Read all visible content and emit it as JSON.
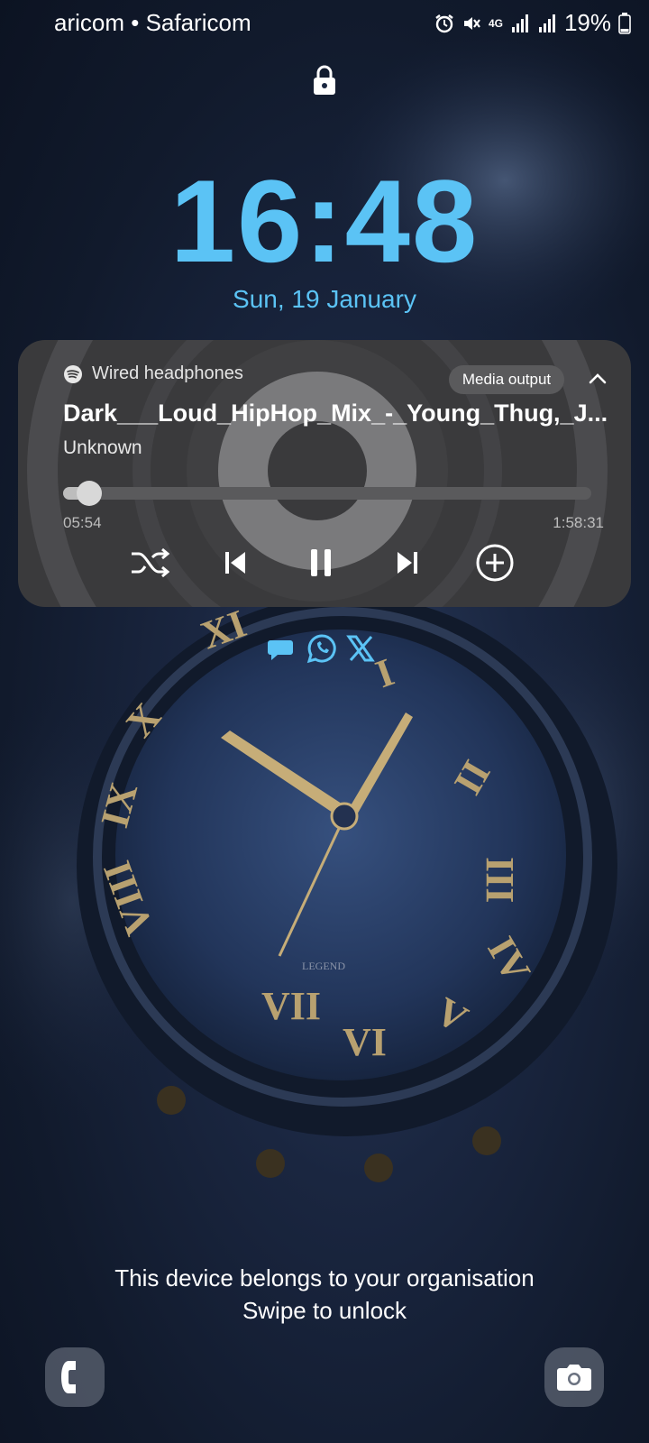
{
  "status_bar": {
    "carrier": "aricom • Safaricom",
    "network": "4G",
    "battery": "19%",
    "icons": [
      "alarm-icon",
      "mute-icon",
      "4g-icon",
      "signal-icon",
      "signal-icon",
      "battery-icon"
    ]
  },
  "lock": {
    "icon": "lock-icon"
  },
  "clock": {
    "time": "16:48",
    "date": "Sun, 19 January"
  },
  "media": {
    "app_icon": "spotify-icon",
    "device": "Wired headphones",
    "output_button": "Media output",
    "collapse_icon": "chevron-up-icon",
    "title": "Dark___Loud_HipHop_Mix_-_Young_Thug,_J...",
    "artist": "Unknown",
    "elapsed": "05:54",
    "total": "1:58:31",
    "progress_fraction": 0.05,
    "controls": [
      "shuffle-icon",
      "previous-icon",
      "pause-icon",
      "next-icon",
      "add-icon"
    ]
  },
  "notifications": [
    "messages-icon",
    "whatsapp-icon",
    "x-icon"
  ],
  "footer": {
    "owner_text": "This device belongs to your organisation",
    "unlock_text": "Swipe to unlock",
    "left_shortcut": "phone-icon",
    "right_shortcut": "camera-icon"
  },
  "colors": {
    "clock": "#5bc3f5",
    "card": "#3a3a3c",
    "notif_icon": "#5bc3f5"
  }
}
